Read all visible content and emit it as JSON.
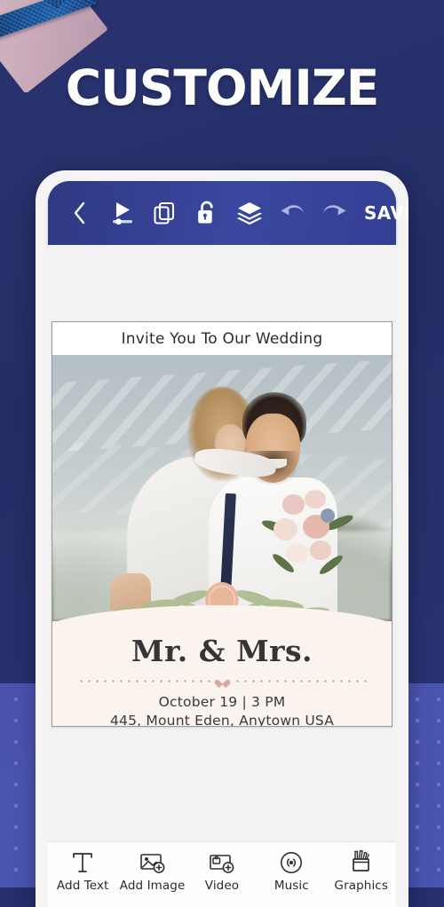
{
  "promo": {
    "headline": "CUSTOMIZE",
    "background_color": "#242f6b",
    "accent_dots_color": "#4c57b4",
    "decoration": "ribbon-corner"
  },
  "app": {
    "toolbar": {
      "back_icon": "chevron-left-icon",
      "items": [
        {
          "name": "preview-play-icon",
          "label": "Preview"
        },
        {
          "name": "duplicate-icon",
          "label": "Duplicate"
        },
        {
          "name": "unlock-icon",
          "label": "Unlock"
        },
        {
          "name": "layers-icon",
          "label": "Layers"
        },
        {
          "name": "undo-icon",
          "label": "Undo"
        },
        {
          "name": "redo-icon",
          "label": "Redo"
        }
      ],
      "save_label": "SAVE",
      "bar_color": "#3a47a0"
    },
    "card": {
      "title": "Invite You To Our Wedding",
      "photo_alt": "Couple embracing outdoors with bouquet",
      "names": "Mr. & Mrs.",
      "date_time": "October 19 | 3 PM",
      "address": "445, Mount Eden, Anytown USA",
      "seal_color": "#e9b69c",
      "cream_color": "#faf3ee",
      "heart_color": "#d9a99d"
    },
    "bottom_toolbar": {
      "items": [
        {
          "icon": "add-text-icon",
          "label": "Add Text"
        },
        {
          "icon": "add-image-icon",
          "label": "Add Image"
        },
        {
          "icon": "video-icon",
          "label": "Video"
        },
        {
          "icon": "music-icon",
          "label": "Music"
        },
        {
          "icon": "graphics-icon",
          "label": "Graphics"
        }
      ]
    }
  }
}
